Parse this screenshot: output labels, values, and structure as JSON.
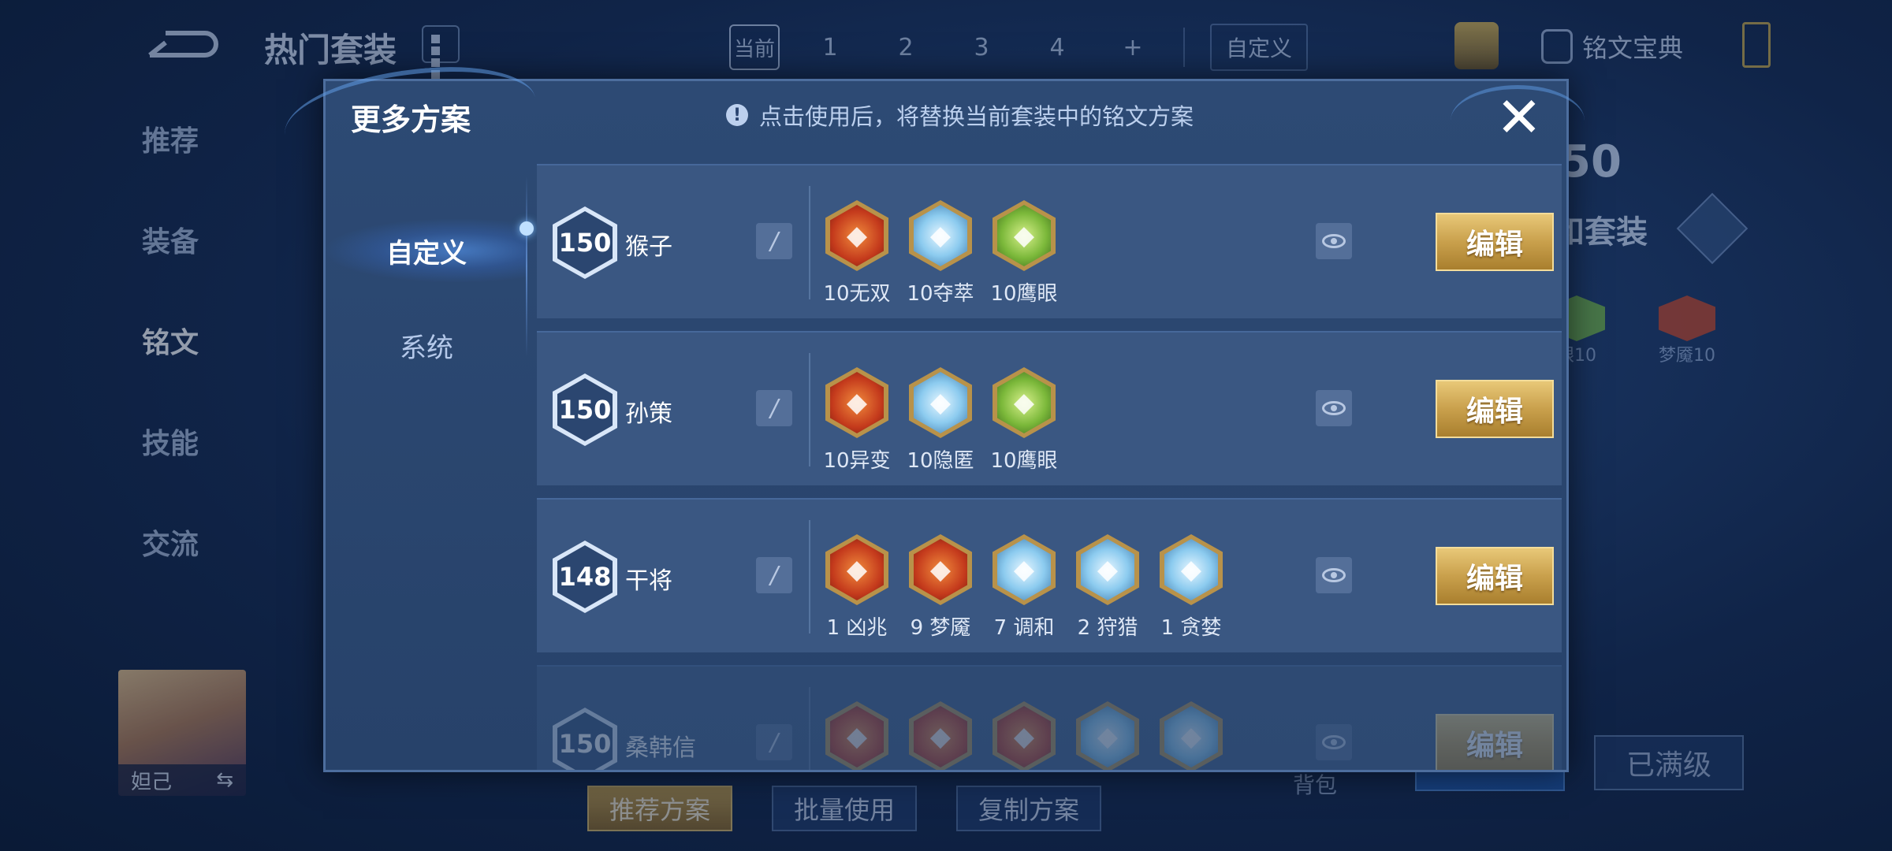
{
  "background": {
    "title": "热门套装",
    "pages": [
      "当前",
      "1",
      "2",
      "3",
      "4",
      "+"
    ],
    "custom_tab": "自定义",
    "codex": "铭文宝典",
    "nav": [
      "推荐",
      "装备",
      "铭文",
      "技能",
      "交流"
    ],
    "right_level": "50",
    "right_title": "和套装",
    "right_runes": [
      "眼10",
      "梦魇10"
    ],
    "hero_name": "妲己",
    "bottom_buttons": [
      "推荐方案",
      "批量使用",
      "复制方案"
    ],
    "bag_label": "背包",
    "maxed_label": "已满级"
  },
  "modal": {
    "title": "更多方案",
    "notice": "点击使用后，将替换当前套装中的铭文方案",
    "close_icon": "close-icon",
    "side_tabs": [
      "自定义",
      "系统"
    ],
    "active_tab": "自定义",
    "edit_label": "编辑",
    "plans": [
      {
        "level": "150",
        "name": "猴子",
        "runes": [
          {
            "label": "10无双",
            "color": "red",
            "icon": "rune-wushuang-icon"
          },
          {
            "label": "10夺萃",
            "color": "blue",
            "icon": "rune-duocui-icon"
          },
          {
            "label": "10鹰眼",
            "color": "green",
            "icon": "rune-yingyan-icon"
          }
        ]
      },
      {
        "level": "150",
        "name": "孙策",
        "runes": [
          {
            "label": "10异变",
            "color": "red",
            "icon": "rune-yibian-icon"
          },
          {
            "label": "10隐匿",
            "color": "blue",
            "icon": "rune-yinni-icon"
          },
          {
            "label": "10鹰眼",
            "color": "green",
            "icon": "rune-yingyan-icon"
          }
        ]
      },
      {
        "level": "148",
        "name": "干将",
        "runes": [
          {
            "label": "1 凶兆",
            "color": "red",
            "icon": "rune-xiongzhao-icon"
          },
          {
            "label": "9 梦魇",
            "color": "red",
            "icon": "rune-mengyan-icon"
          },
          {
            "label": "7 调和",
            "color": "blue",
            "icon": "rune-tiaohe-icon"
          },
          {
            "label": "2 狩猎",
            "color": "blue",
            "icon": "rune-shoulie-icon"
          },
          {
            "label": "1 贪婪",
            "color": "blue",
            "icon": "rune-tanlan-icon"
          }
        ]
      },
      {
        "level": "150",
        "name": "桑韩信",
        "runes": [
          {
            "label": "",
            "color": "red",
            "icon": "rune-icon"
          },
          {
            "label": "",
            "color": "red",
            "icon": "rune-icon"
          },
          {
            "label": "",
            "color": "red",
            "icon": "rune-icon"
          },
          {
            "label": "",
            "color": "blue",
            "icon": "rune-icon"
          },
          {
            "label": "",
            "color": "blue",
            "icon": "rune-icon"
          }
        ]
      }
    ]
  },
  "colors": {
    "accent_gold": "#c9a04c",
    "panel": "#2d4a74",
    "row": "#3a5782"
  }
}
